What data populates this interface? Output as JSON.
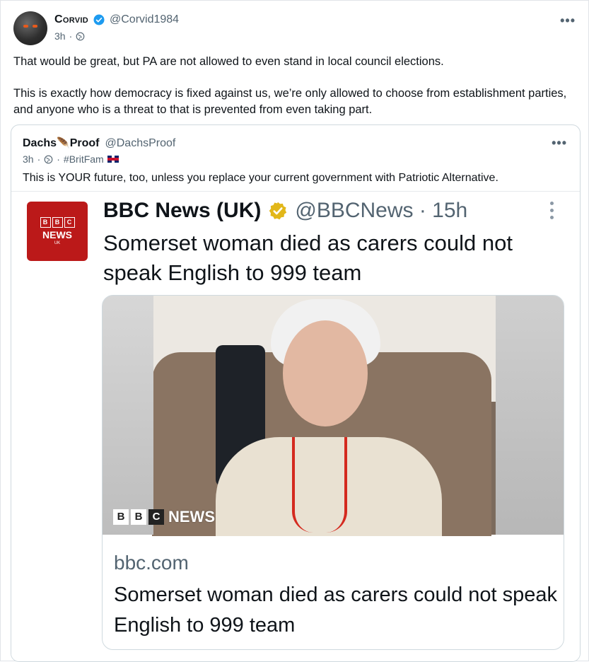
{
  "post": {
    "author_name": "Corvid",
    "author_handle": "@Corvid1984",
    "time": "3h",
    "visibility_icon": "globe-icon",
    "more_label": "•••",
    "paragraphs": [
      "That would be great, but PA are not allowed to even stand in local council elections.",
      "This is exactly how democracy is fixed against us, we’re only allowed to choose from establishment parties, and anyone who is a threat to that is prevented from even taking part."
    ]
  },
  "quoted": {
    "author_name_part1": "Dachs",
    "author_name_feather": "🪶",
    "author_name_part2": "Proof",
    "author_handle": "@DachsProof",
    "time": "3h",
    "hashtag": "#BritFam",
    "more_label": "•••",
    "text": "This is YOUR future, too, unless you replace your current government with Patriotic Alternative."
  },
  "screenshot": {
    "logo_letters": [
      "B",
      "B",
      "C"
    ],
    "logo_news": "NEWS",
    "logo_uk": "UK",
    "account_name": "BBC News (UK)",
    "account_handle": "@BBCNews · 15h",
    "headline": "Somerset woman died as carers could not speak English to 999 team",
    "card": {
      "watermark_letters": [
        "B",
        "B",
        "C"
      ],
      "watermark_news": "NEWS",
      "domain": "bbc.com",
      "title": "Somerset woman died as carers could not speak English to 999 team"
    }
  },
  "colors": {
    "verified_blue": "#1d9bf0",
    "verified_gold": "#e2b719",
    "bbc_red": "#bb1919"
  }
}
